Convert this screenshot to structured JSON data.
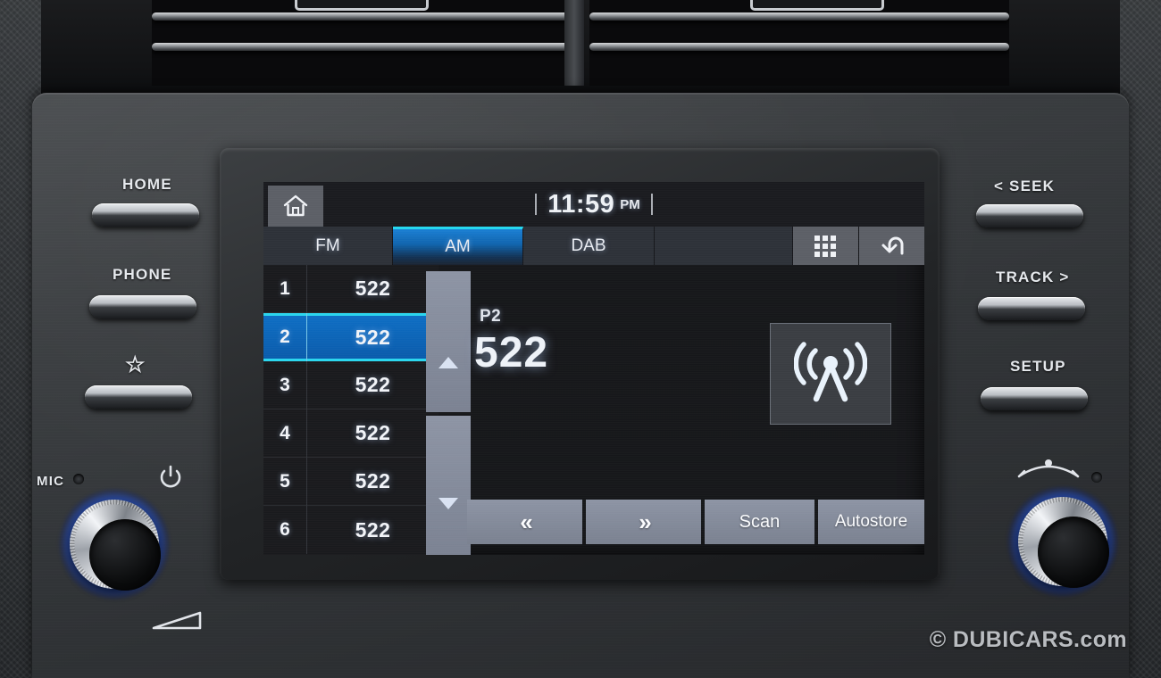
{
  "device": {
    "type": "car-infotainment-head-unit",
    "watermark": "© DUBICARS.com"
  },
  "screen": {
    "statusbar": {
      "home_icon": "home-icon",
      "time": "11:59",
      "ampm": "PM"
    },
    "tabs": [
      {
        "label": "FM",
        "active": false
      },
      {
        "label": "AM",
        "active": true
      },
      {
        "label": "DAB",
        "active": false
      },
      {
        "label": "",
        "active": false
      }
    ],
    "tab_icons": [
      {
        "name": "grid-menu-icon"
      },
      {
        "name": "back-arrow-icon"
      }
    ],
    "presets": [
      {
        "number": "1",
        "frequency": "522",
        "selected": false
      },
      {
        "number": "2",
        "frequency": "522",
        "selected": true
      },
      {
        "number": "3",
        "frequency": "522",
        "selected": false
      },
      {
        "number": "4",
        "frequency": "522",
        "selected": false
      },
      {
        "number": "5",
        "frequency": "522",
        "selected": false
      },
      {
        "number": "6",
        "frequency": "522",
        "selected": false
      }
    ],
    "scroll": {
      "up_icon": "triangle-up-icon",
      "down_icon": "triangle-down-icon"
    },
    "now_playing": {
      "preset_label": "P2",
      "frequency": "522",
      "source_icon": "radio-antenna-icon"
    },
    "buttons": [
      {
        "label": "«",
        "name": "seek-down-button"
      },
      {
        "label": "»",
        "name": "seek-up-button"
      },
      {
        "label": "Scan",
        "name": "scan-button"
      },
      {
        "label": "Autostore",
        "name": "autostore-button"
      }
    ],
    "colors": {
      "accent_cyan": "#2ad6ee",
      "accent_blue": "#0e6ec4",
      "button_gray": "#8d94a4",
      "screen_bg": "#16171a"
    }
  },
  "hardware": {
    "left_buttons": [
      {
        "label": "HOME",
        "name": "home-hard-button"
      },
      {
        "label": "PHONE",
        "name": "phone-hard-button"
      },
      {
        "label": "☆",
        "name": "favorite-hard-button"
      }
    ],
    "right_buttons": [
      {
        "label": "< SEEK",
        "name": "seek-hard-button"
      },
      {
        "label": "TRACK >",
        "name": "track-hard-button"
      },
      {
        "label": "SETUP",
        "name": "setup-hard-button"
      }
    ],
    "left_knob": {
      "mic_label": "MIC",
      "power_icon": "power-icon",
      "volume_icon": "volume-wedge-icon",
      "name": "power-volume-knob"
    },
    "right_knob": {
      "tune_icon": "tune-arc-icon",
      "name": "tune-knob"
    }
  }
}
